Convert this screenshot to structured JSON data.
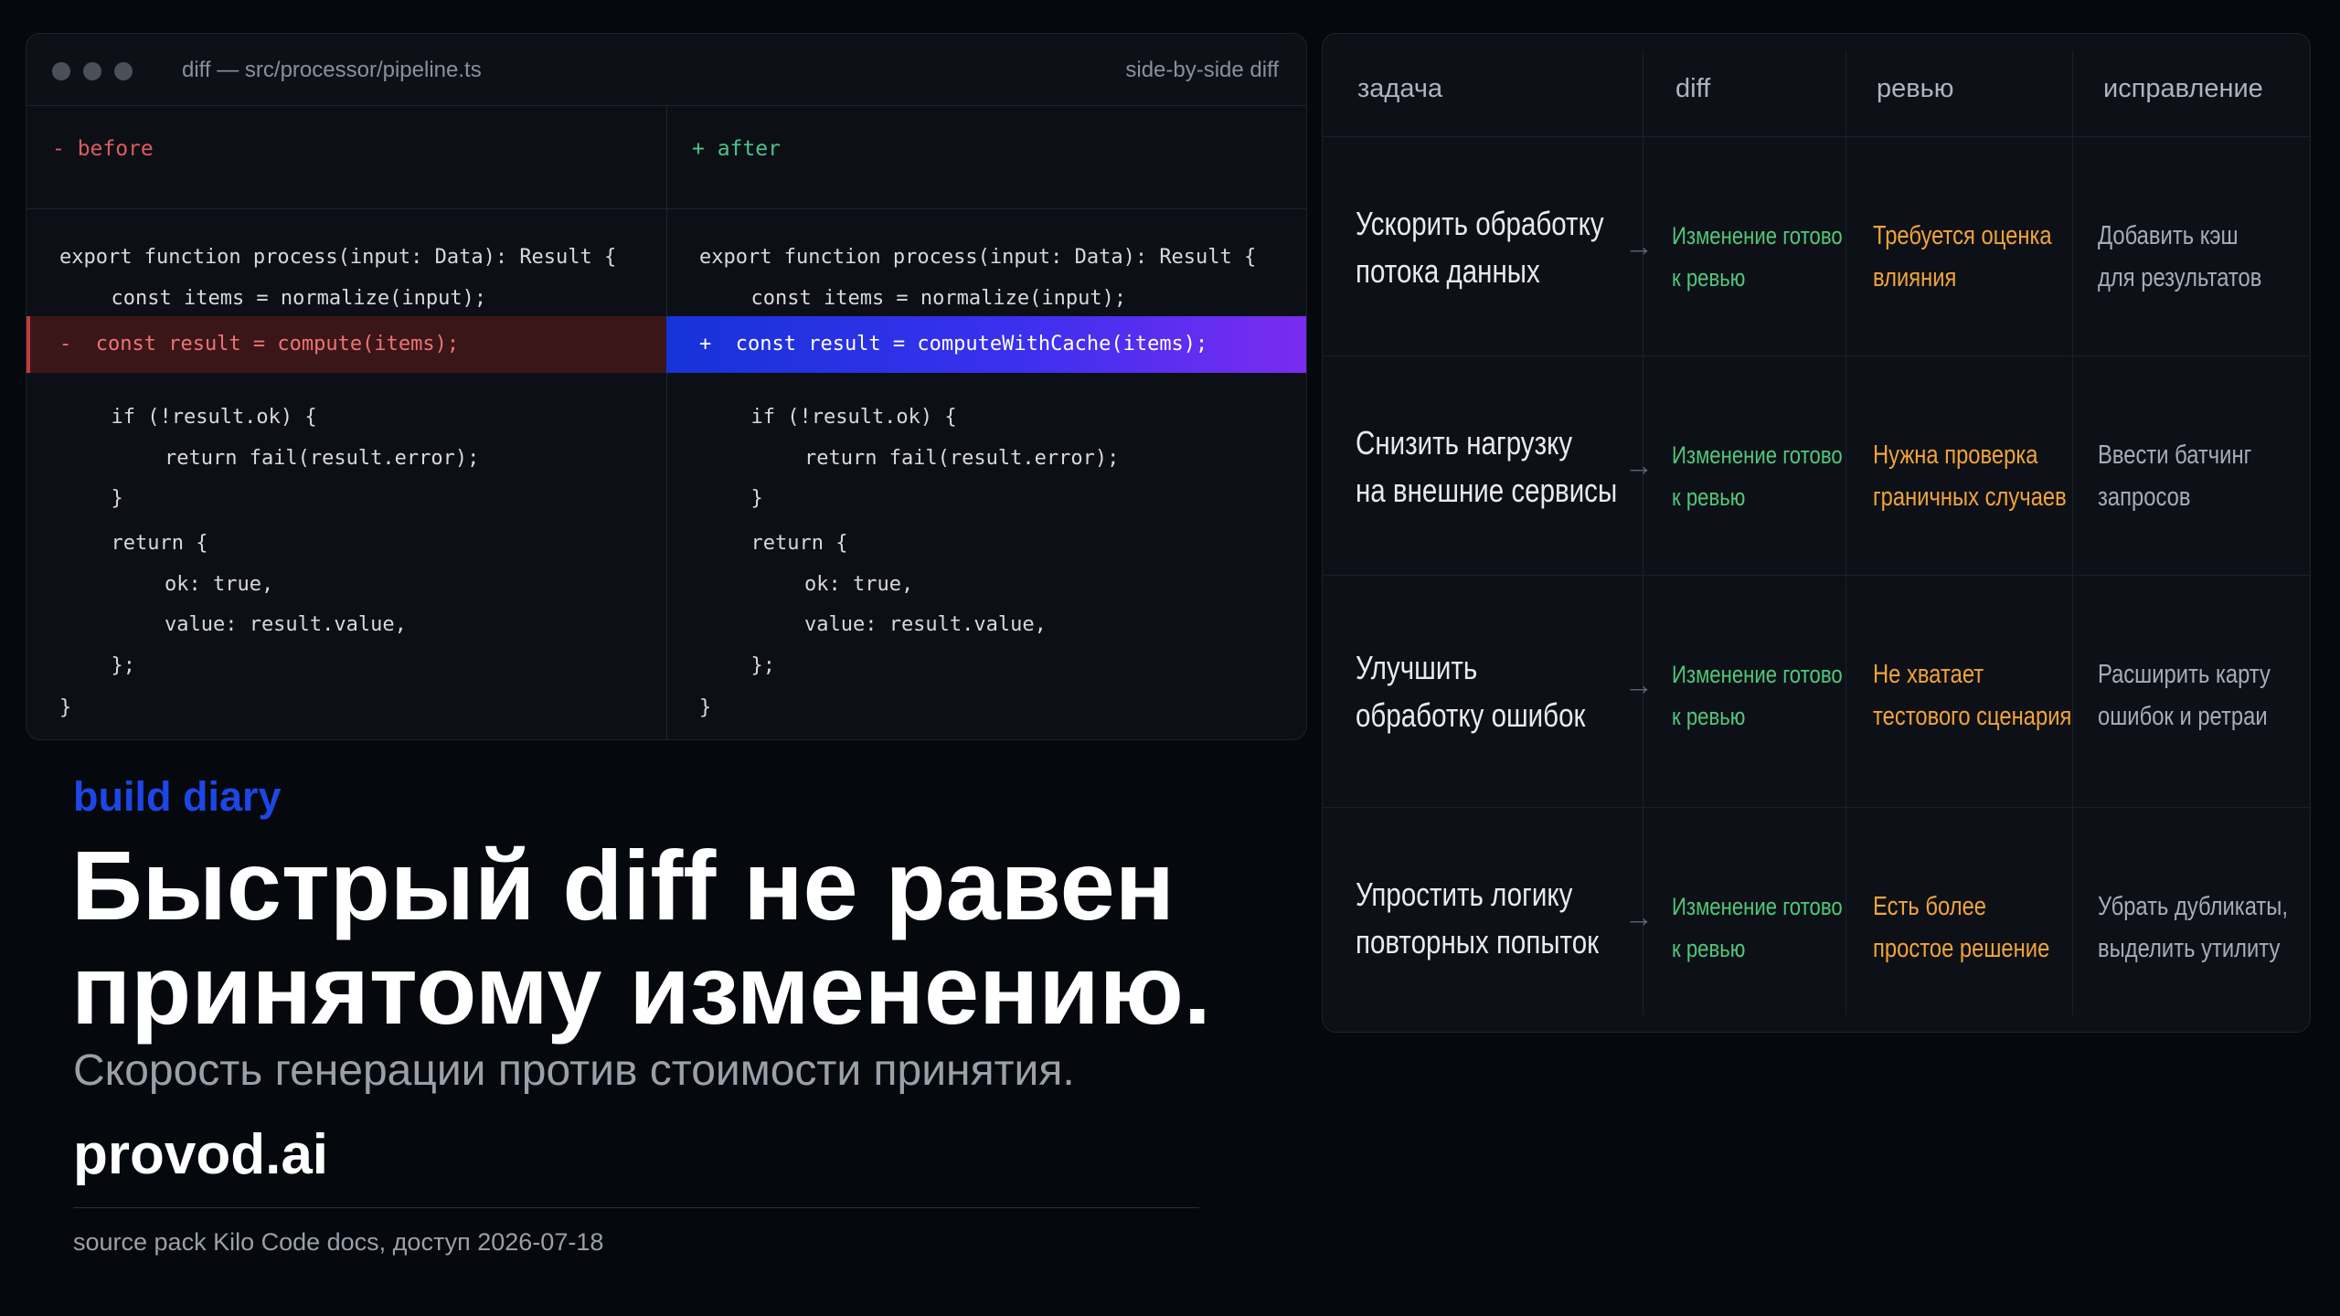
{
  "diff": {
    "title": "diff — src/processor/pipeline.ts",
    "mode": "side-by-side diff",
    "before_label": "- before",
    "after_label": "+ after",
    "before_lines": [
      "export function process(input: Data): Result {",
      "  const items = normalize(input);",
      "-  const result = compute(items);",
      "  if (!result.ok) {",
      "    return fail(result.error);",
      "  }",
      "  return {",
      "    ok: true,",
      "    value: result.value,",
      "  };",
      "}"
    ],
    "after_lines": [
      "export function process(input: Data): Result {",
      "  const items = normalize(input);",
      "+  const result = computeWithCache(items);",
      "  if (!result.ok) {",
      "    return fail(result.error);",
      "  }",
      "  return {",
      "    ok: true,",
      "    value: result.value,",
      "  };",
      "}"
    ]
  },
  "hero": {
    "kicker": "build diary",
    "headline_line1": "Быстрый diff не равен",
    "headline_line2": "принятому изменению.",
    "subtitle": "Скорость генерации против стоимости принятия.",
    "brand": "provod.ai",
    "source": "source pack Kilo Code docs, доступ 2026-07-18"
  },
  "table": {
    "headers": [
      "задача",
      "diff",
      "ревью",
      "исправление"
    ],
    "rows": [
      {
        "task": [
          "Ускорить обработку",
          "потока данных"
        ],
        "diff": [
          "Изменение готово",
          "к ревью"
        ],
        "review": [
          "Требуется оценка",
          "влияния"
        ],
        "fix": [
          "Добавить кэш",
          "для результатов"
        ]
      },
      {
        "task": [
          "Снизить нагрузку",
          "на внешние сервисы"
        ],
        "diff": [
          "Изменение готово",
          "к ревью"
        ],
        "review": [
          "Нужна проверка",
          "граничных случаев"
        ],
        "fix": [
          "Ввести батчинг",
          "запросов"
        ]
      },
      {
        "task": [
          "Улучшить",
          "обработку ошибок"
        ],
        "diff": [
          "Изменение готово",
          "к ревью"
        ],
        "review": [
          "Не хватает",
          "тестового сценария"
        ],
        "fix": [
          "Расширить карту",
          "ошибок и ретраи"
        ]
      },
      {
        "task": [
          "Упростить логику",
          "повторных попыток"
        ],
        "diff": [
          "Изменение готово",
          "к ревью"
        ],
        "review": [
          "Есть более",
          "простое решение"
        ],
        "fix": [
          "Убрать дубликаты,",
          "выделить утилиту"
        ]
      }
    ],
    "arrow": "→"
  },
  "colors": {
    "accent_blue": "#1e46e6",
    "added_gradient_start": "#1633d8",
    "added_gradient_end": "#7b2cf0",
    "removed": "#e25a5a",
    "diff_status": "#52c67a",
    "review_status": "#f2a33a"
  }
}
